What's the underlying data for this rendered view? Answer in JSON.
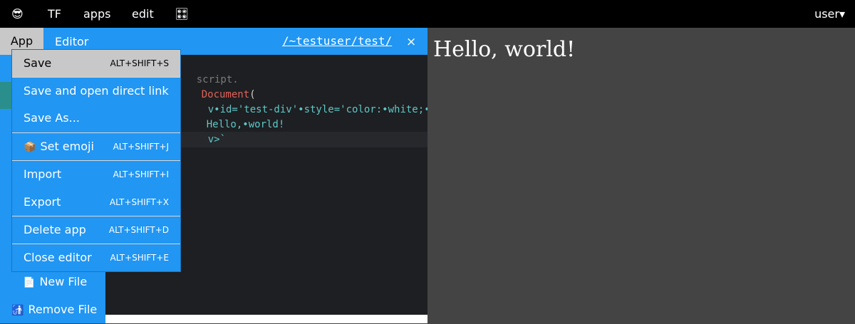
{
  "top_bar": {
    "emoji_icon": "sunglasses-face-emoji",
    "emoji_glyph": "😎",
    "items": [
      "TF",
      "apps",
      "edit"
    ],
    "grid_icon": "dice-grid-icon",
    "grid_glyph": "🎛",
    "user_label": "user▾"
  },
  "editor": {
    "app_tab": "App",
    "editor_tab": "Editor",
    "path": "/~testuser/test/",
    "close": "×",
    "code": {
      "line1": "script.",
      "line2_fn": "Document",
      "line2_punc": "(",
      "line3": "v•id='test-div'•style='color:•white;•f",
      "line4": "Hello,•world!",
      "line5": "v>`"
    }
  },
  "preview": {
    "hello": "Hello, world!"
  },
  "sidebar": {
    "new_file_icon": "page-icon",
    "new_file_glyph": "📄",
    "new_file": "New File",
    "remove_file_icon": "person-in-trash-icon",
    "remove_file_glyph": "🚮",
    "remove_file": "Remove File"
  },
  "app_menu": {
    "items": [
      {
        "label": "Save",
        "shortcut": "ALT+SHIFT+S"
      },
      {
        "label": "Save and open direct link",
        "shortcut": ""
      },
      {
        "label": "Save As...",
        "shortcut": ""
      },
      {
        "label": "Set emoji",
        "shortcut": "ALT+SHIFT+J",
        "icon": "package-icon",
        "glyph": "📦"
      },
      {
        "label": "Import",
        "shortcut": "ALT+SHIFT+I"
      },
      {
        "label": "Export",
        "shortcut": "ALT+SHIFT+X"
      },
      {
        "label": "Delete app",
        "shortcut": "ALT+SHIFT+D"
      },
      {
        "label": "Close editor",
        "shortcut": "ALT+SHIFT+E"
      }
    ]
  }
}
